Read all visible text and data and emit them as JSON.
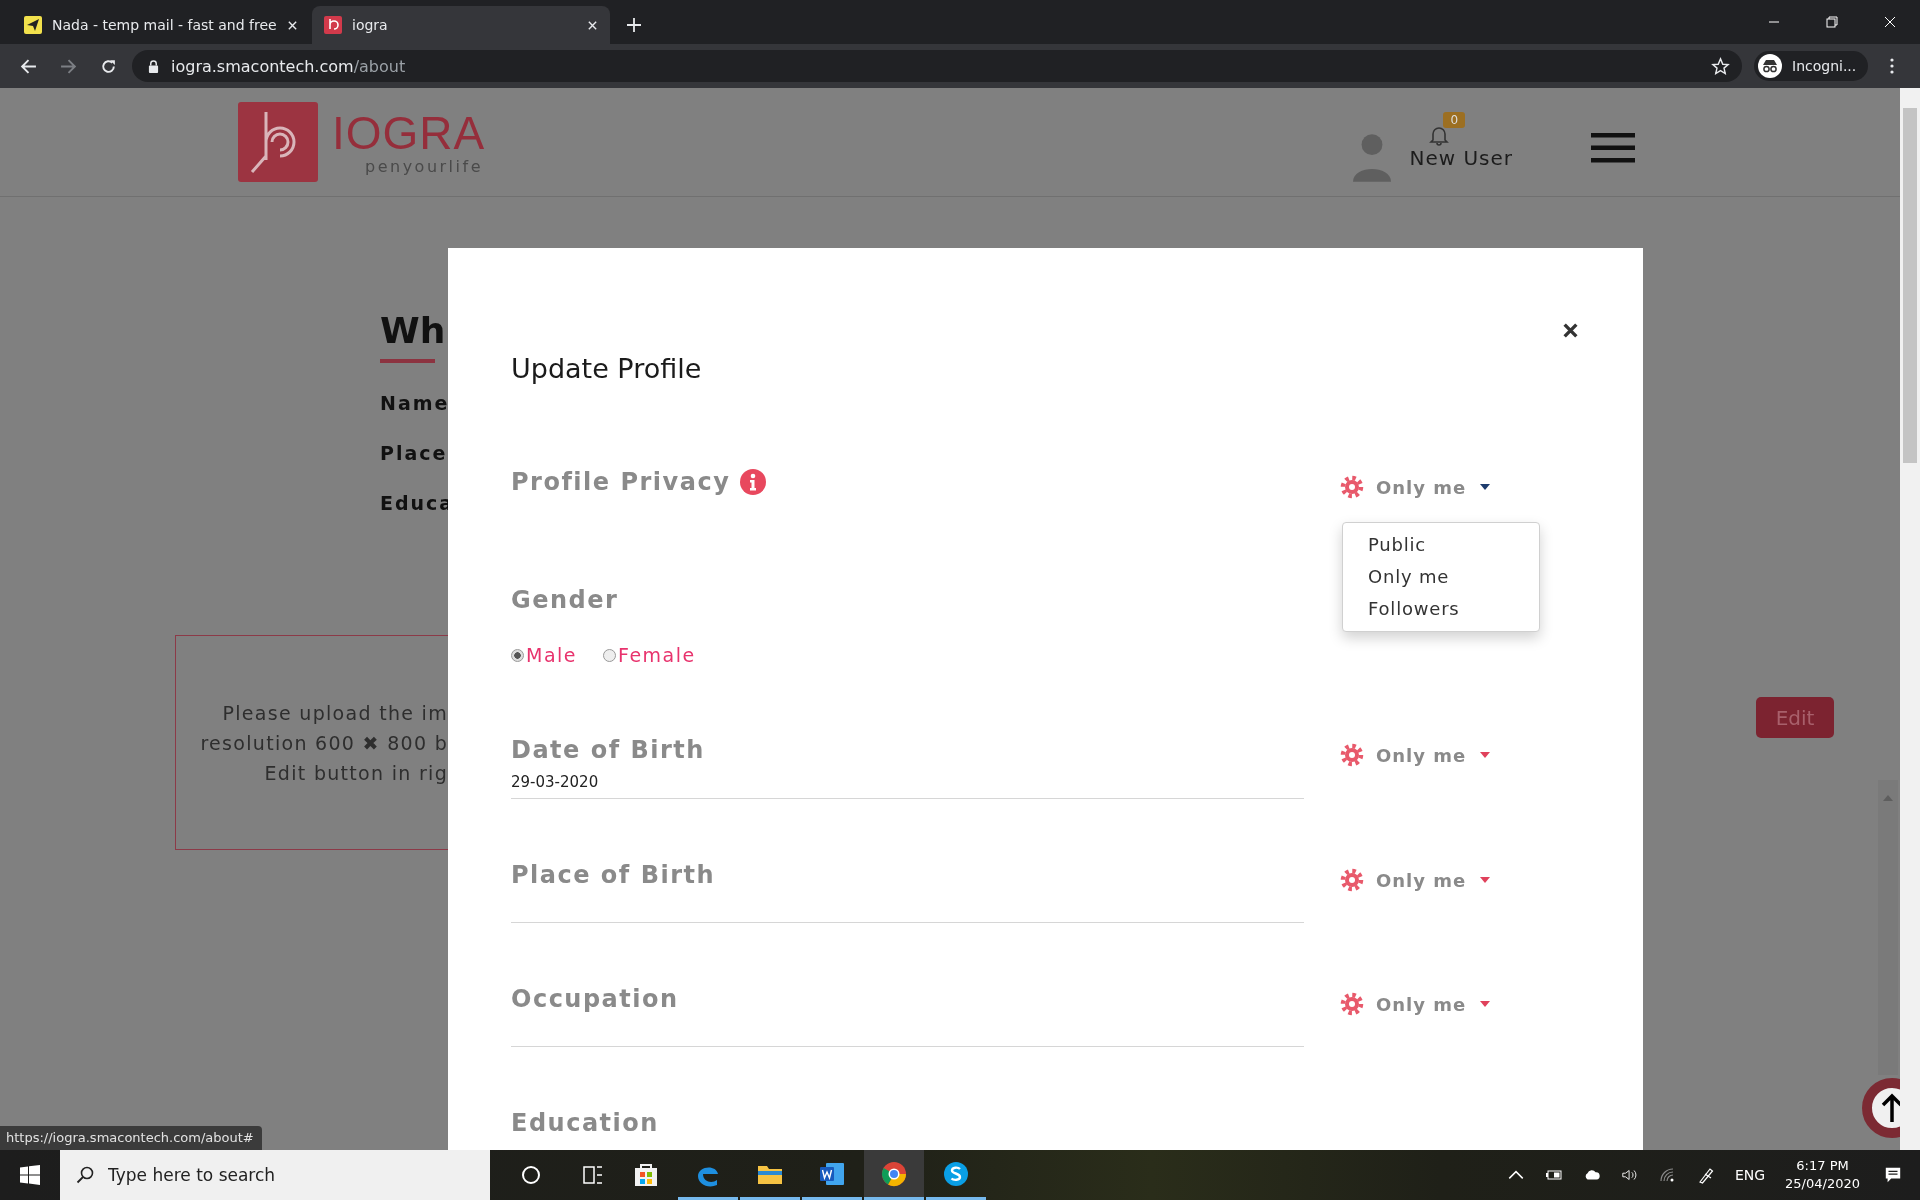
{
  "browser": {
    "tabs": [
      {
        "title": "Nada - temp mail - fast and free",
        "kind": "mail",
        "selected": false
      },
      {
        "title": "iogra",
        "kind": "site",
        "selected": true
      }
    ],
    "url": {
      "host": "iogra.smacontech.com",
      "path": "/about"
    },
    "profile": "Incogni...",
    "status_url": "https://iogra.smacontech.com/about#"
  },
  "header": {
    "logo": {
      "name": "IOGRA",
      "tagline": "penyourlife"
    },
    "notifications": "0",
    "user": "New User"
  },
  "page": {
    "heading": "Wh",
    "details": [
      "Name",
      "Place",
      "Educa"
    ],
    "upload_note": "Please upload the im\nresolution 600 ✖ 800 b\nEdit button in rig",
    "edit_button": "Edit"
  },
  "modal": {
    "title": "Update Profile",
    "privacy": {
      "label": "Profile Privacy",
      "setting": "Only me",
      "open": true,
      "options": [
        "Public",
        "Only me",
        "Followers"
      ]
    },
    "gender": {
      "label": "Gender",
      "options": [
        {
          "label": "Male",
          "selected": true
        },
        {
          "label": "Female",
          "selected": false
        }
      ]
    },
    "fields": [
      {
        "label": "Date of Birth",
        "value": "29-03-2020",
        "setting": "Only me",
        "open": false
      },
      {
        "label": "Place of Birth",
        "setting": "Only me",
        "open": false
      },
      {
        "label": "Occupation",
        "setting": "Only me",
        "open": false
      },
      {
        "label": "Education"
      }
    ]
  },
  "taskbar": {
    "search_placeholder": "Type here to search",
    "apps": [
      {
        "kind": "store",
        "running": false,
        "active": false
      },
      {
        "kind": "edge",
        "running": true,
        "active": false
      },
      {
        "kind": "explorer",
        "running": true,
        "active": false
      },
      {
        "kind": "word",
        "running": true,
        "active": false
      },
      {
        "kind": "chrome",
        "running": true,
        "active": true
      },
      {
        "kind": "skype",
        "running": true,
        "active": false
      }
    ],
    "language": "ENG",
    "time": "6:17 PM",
    "date": "25/04/2020"
  }
}
